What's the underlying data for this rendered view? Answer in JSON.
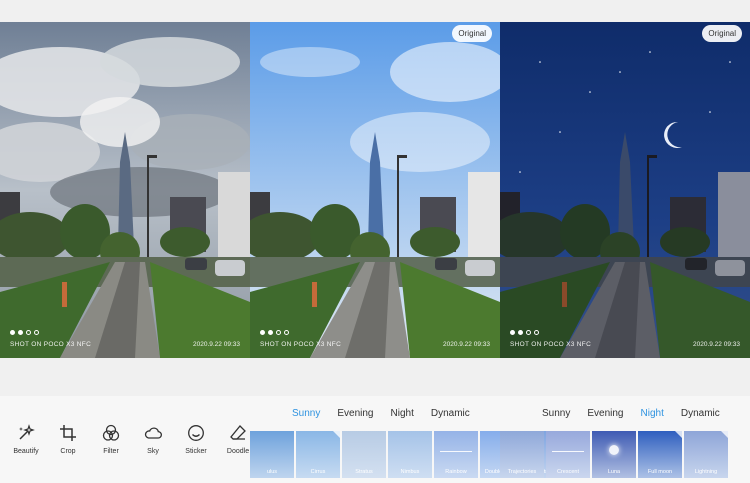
{
  "photos": [
    {
      "label": "",
      "shot_text": "SHOT ON POCO X3 NFC",
      "date_text": "2020.9.22  09:33",
      "theme": "cloudy"
    },
    {
      "label": "Original",
      "shot_text": "SHOT ON POCO X3 NFC",
      "date_text": "2020.9.22  09:33",
      "theme": "sunny"
    },
    {
      "label": "Original",
      "shot_text": "SHOT ON POCO X3 NFC",
      "date_text": "2020.9.22  09:33",
      "theme": "night"
    }
  ],
  "tools": [
    {
      "label": "Beautify",
      "icon": "sparkle-wand-icon"
    },
    {
      "label": "Crop",
      "icon": "crop-icon"
    },
    {
      "label": "Filter",
      "icon": "filter-circles-icon"
    },
    {
      "label": "Sky",
      "icon": "cloud-icon"
    },
    {
      "label": "Sticker",
      "icon": "smiley-icon"
    },
    {
      "label": "Doodle",
      "icon": "eraser-icon"
    }
  ],
  "tabs_panel1": [
    {
      "label": "Sunny",
      "active": true
    },
    {
      "label": "Evening",
      "active": false
    },
    {
      "label": "Night",
      "active": false
    },
    {
      "label": "Dynamic",
      "active": false
    }
  ],
  "tabs_panel2": [
    {
      "label": "Sunny",
      "active": false
    },
    {
      "label": "Evening",
      "active": false
    },
    {
      "label": "Night",
      "active": true
    },
    {
      "label": "Dynamic",
      "active": false
    }
  ],
  "strip1": [
    {
      "label": "ulus",
      "color": "#6ea2dc",
      "deco": "none"
    },
    {
      "label": "Cirrus",
      "color": "#8ab7e6",
      "deco": "tag"
    },
    {
      "label": "Stratus",
      "color": "#b7cbe4",
      "deco": "none"
    },
    {
      "label": "Nimbus",
      "color": "#a5c3e8",
      "deco": "none"
    },
    {
      "label": "Rainbow",
      "color": "#95b3e7",
      "deco": "line"
    },
    {
      "label": "Double rainbo",
      "color": "#85adeb",
      "deco": "tag"
    },
    {
      "label": "ar tracks",
      "color": "#7ea4e0",
      "deco": "none"
    }
  ],
  "strip2": [
    {
      "label": "Trajectories",
      "color": "#8fa8d9",
      "deco": "none"
    },
    {
      "label": "Crescent",
      "color": "#97a9dc",
      "deco": "line"
    },
    {
      "label": "Luna",
      "color": "#3f5bb3",
      "deco": "orb"
    },
    {
      "label": "Full moon",
      "color": "#2f5fbf",
      "deco": "tag"
    },
    {
      "label": "Lightning",
      "color": "#8ea5d8",
      "deco": "tag"
    }
  ],
  "colors": {
    "accent": "#2f93e0"
  }
}
